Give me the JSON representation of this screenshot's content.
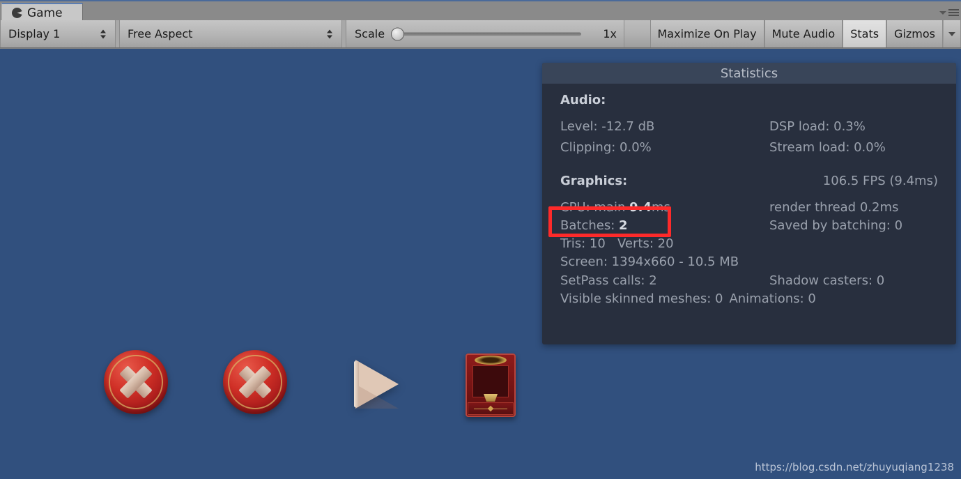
{
  "window": {
    "tab_label": "Game",
    "tab_icon": "game-view-icon",
    "panel_menu_icon": "hamburger-menu-icon",
    "panel_dropdown_icon": "chevron-down-icon"
  },
  "toolbar": {
    "display_dropdown": "Display 1",
    "aspect_dropdown": "Free Aspect",
    "scale_label": "Scale",
    "scale_value": "1x",
    "scale_slider_position": 0,
    "maximize_on_play": "Maximize On Play",
    "mute_audio": "Mute Audio",
    "stats": "Stats",
    "stats_active": true,
    "gizmos": "Gizmos",
    "gizmos_dropdown_icon": "chevron-down-icon"
  },
  "gameview": {
    "background_color": "#31507e",
    "sprites": [
      {
        "name": "close-button-sprite-1",
        "icon": "red-circle-x-button"
      },
      {
        "name": "close-button-sprite-2",
        "icon": "red-circle-x-button"
      },
      {
        "name": "play-arrow-sprite",
        "icon": "triangle-play-arrow"
      },
      {
        "name": "ornate-panel-sprite",
        "icon": "red-ornate-window-frame"
      }
    ],
    "watermark": "https://blog.csdn.net/zhuyuqiang1238"
  },
  "statistics": {
    "title": "Statistics",
    "audio": {
      "heading": "Audio:",
      "level_label": "Level:",
      "level_value": "-12.7 dB",
      "dsp_label": "DSP load:",
      "dsp_value": "0.3%",
      "clipping_label": "Clipping:",
      "clipping_value": "0.0%",
      "stream_label": "Stream load:",
      "stream_value": "0.0%",
      "level_line": "Level: -12.7 dB",
      "dsp_line": "DSP load: 0.3%",
      "clipping_line": "Clipping: 0.0%",
      "stream_line": "Stream load: 0.0%"
    },
    "graphics": {
      "heading": "Graphics:",
      "fps": "106.5 FPS (9.4ms)",
      "cpu_prefix": "CPU: main ",
      "cpu_main_ms": "9.4",
      "cpu_suffix": "ms",
      "render_thread": "render thread 0.2ms",
      "batches_label": "Batches:",
      "batches_value": "2",
      "saved_by_batching": "Saved by batching: 0",
      "tris": "Tris: 10",
      "verts": "Verts: 20",
      "screen": "Screen: 1394x660 - 10.5 MB",
      "setpass": "SetPass calls: 2",
      "shadow_casters": "Shadow casters: 0",
      "visible_skinned": "Visible skinned meshes: 0",
      "animations": "Animations: 0"
    }
  },
  "annotation": {
    "color": "#fd2a2a",
    "target": "batches-row"
  }
}
